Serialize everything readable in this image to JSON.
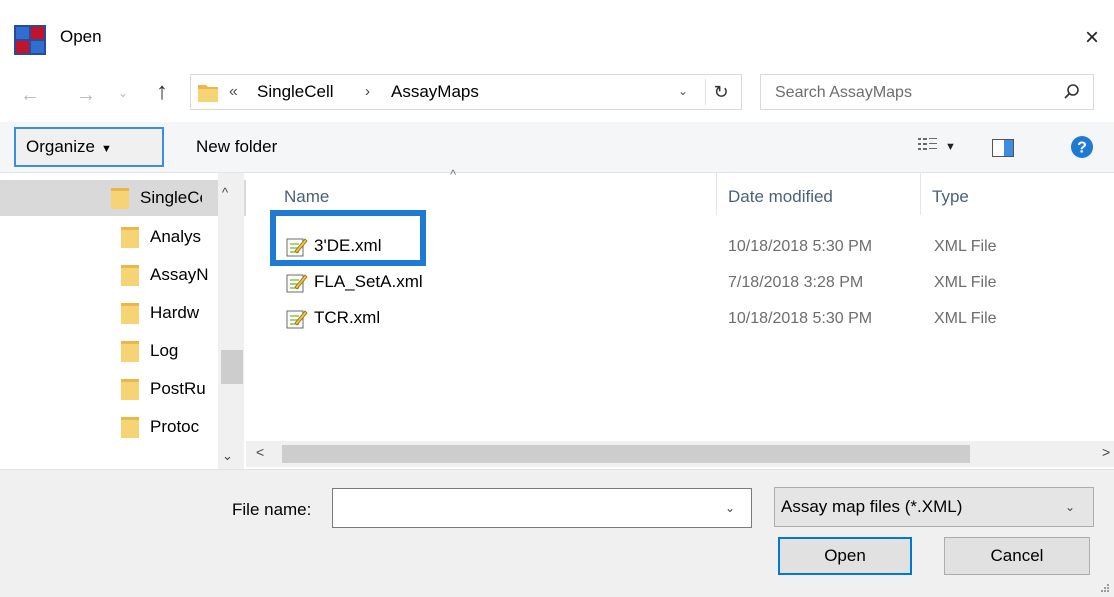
{
  "window": {
    "title": "Open",
    "close_glyph": "×"
  },
  "nav": {
    "back_glyph": "←",
    "forward_glyph": "→",
    "recent_glyph": "⌄",
    "up_glyph": "↑",
    "breadcrumb_overflow": "«",
    "breadcrumb": [
      "SingleCell",
      "AssayMaps"
    ],
    "breadcrumb_sep": "›",
    "dropdown_glyph": "⌄",
    "refresh_glyph": "↻"
  },
  "search": {
    "placeholder": "Search AssayMaps",
    "value": ""
  },
  "toolbar": {
    "organize_label": "Organize",
    "organize_caret": "▼",
    "new_folder_label": "New folder",
    "view_caret": "▼",
    "accent": "#1f7ad2"
  },
  "navpane": {
    "items": [
      "SingleCe",
      "Analys",
      "AssayN",
      "Hardw",
      "Log",
      "PostRu",
      "Protoc"
    ],
    "scroll_up": "^",
    "scroll_down": "⌄"
  },
  "columns": {
    "name": "Name",
    "date": "Date modified",
    "type": "Type",
    "sort_glyph": "^"
  },
  "files": [
    {
      "name": "3'DE.xml",
      "date": "10/18/2018 5:30 PM",
      "type": "XML File"
    },
    {
      "name": "FLA_SetA.xml",
      "date": "7/18/2018 3:28 PM",
      "type": "XML File"
    },
    {
      "name": "TCR.xml",
      "date": "10/18/2018 5:30 PM",
      "type": "XML File"
    }
  ],
  "hscroll": {
    "left_glyph": "<",
    "right_glyph": ">"
  },
  "footer": {
    "filename_label": "File name:",
    "filename_value": "",
    "filename_dd": "⌄",
    "filetype_value": "Assay map files (*.XML)",
    "filetype_dd": "⌄",
    "open_label": "Open",
    "cancel_label": "Cancel"
  }
}
